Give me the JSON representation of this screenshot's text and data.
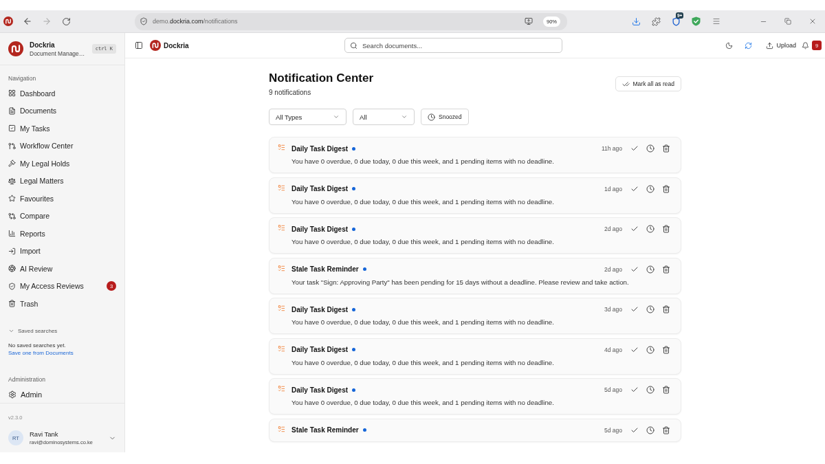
{
  "browser": {
    "url": "demo.**dockria.com**/notifications",
    "zoom": "90%",
    "extension_badge": "9+"
  },
  "sidebar": {
    "brand": {
      "name": "Dockria",
      "subtitle": "Document Manage…",
      "shortcut": "ctrl K"
    },
    "nav_heading": "Navigation",
    "nav_items": [
      {
        "label": "Dashboard",
        "selected": false
      },
      {
        "label": "Documents",
        "selected": false
      },
      {
        "label": "My Tasks",
        "selected": false
      },
      {
        "label": "Workflow Center",
        "selected": false
      },
      {
        "label": "My Legal Holds",
        "selected": false
      },
      {
        "label": "Legal Matters",
        "selected": false
      },
      {
        "label": "Favourites",
        "selected": false
      },
      {
        "label": "Compare",
        "selected": false
      },
      {
        "label": "Reports",
        "selected": false
      },
      {
        "label": "Import",
        "selected": false
      },
      {
        "label": "AI Review",
        "selected": false
      },
      {
        "label": "My Access Reviews",
        "selected": false,
        "badge": "3"
      },
      {
        "label": "Trash",
        "selected": false
      }
    ],
    "saved_searches": {
      "label": "Saved searches",
      "expanded": true,
      "empty_text": "No saved searches yet.",
      "link": "Save one from Documents"
    },
    "admin_heading": "Administration",
    "admin_items": [
      {
        "label": "Admin",
        "selected": false
      }
    ],
    "version": "v2.3.0",
    "user": {
      "initials": "RT",
      "name": "Ravi Tank",
      "email": "ravi@dominosystems.co.ke"
    }
  },
  "header": {
    "brand": "Dockria",
    "search": {
      "placeholder": "Search documents..."
    },
    "upload_label": "Upload",
    "notification_badge": "9"
  },
  "page": {
    "title": "Notification Center",
    "count": "9 notifications",
    "mark_all_label": "Mark all as read",
    "filters": [
      {
        "kind": "select",
        "value": "All Types"
      },
      {
        "kind": "select",
        "value": "All"
      },
      {
        "kind": "toggle",
        "label": "Snoozed",
        "on": false
      }
    ],
    "notifications": [
      {
        "title": "Daily Task Digest",
        "unread": true,
        "time": "11h ago",
        "message": "You have 0 overdue, 0 due today, 0 due this week, and 1 pending items with no deadline."
      },
      {
        "title": "Daily Task Digest",
        "unread": true,
        "time": "1d ago",
        "message": "You have 0 overdue, 0 due today, 0 due this week, and 1 pending items with no deadline."
      },
      {
        "title": "Daily Task Digest",
        "unread": true,
        "time": "2d ago",
        "message": "You have 0 overdue, 0 due today, 0 due this week, and 1 pending items with no deadline."
      },
      {
        "title": "Stale Task Reminder",
        "unread": true,
        "time": "2d ago",
        "message": "Your task \"Sign: Approving Party\" has been pending for 15 days without a deadline. Please review and take action."
      },
      {
        "title": "Daily Task Digest",
        "unread": true,
        "time": "3d ago",
        "message": "You have 0 overdue, 0 due today, 0 due this week, and 1 pending items with no deadline."
      },
      {
        "title": "Daily Task Digest",
        "unread": true,
        "time": "4d ago",
        "message": "You have 0 overdue, 0 due today, 0 due this week, and 1 pending items with no deadline."
      },
      {
        "title": "Daily Task Digest",
        "unread": true,
        "time": "5d ago",
        "message": "You have 0 overdue, 0 due today, 0 due this week, and 1 pending items with no deadline."
      },
      {
        "title": "Stale Task Reminder",
        "unread": true,
        "time": "5d ago"
      }
    ]
  }
}
